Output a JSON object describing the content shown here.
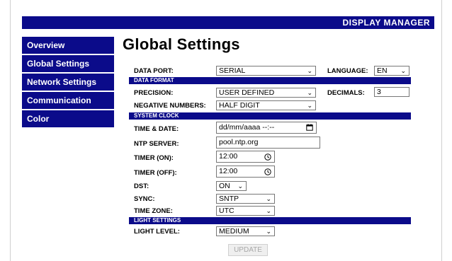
{
  "header": {
    "title": "DISPLAY MANAGER"
  },
  "sidebar": {
    "items": [
      {
        "label": "Overview"
      },
      {
        "label": "Global Settings"
      },
      {
        "label": "Network Settings"
      },
      {
        "label": "Communication"
      },
      {
        "label": "Color"
      }
    ]
  },
  "main": {
    "title": "Global Settings",
    "data_port": {
      "label": "DATA PORT:",
      "value": "SERIAL"
    },
    "language": {
      "label": "LANGUAGE:",
      "value": "EN"
    },
    "data_format": {
      "header": "DATA FORMAT",
      "precision": {
        "label": "PRECISION:",
        "value": "USER DEFINED"
      },
      "decimals": {
        "label": "DECIMALS:",
        "value": "3"
      },
      "negative_numbers": {
        "label": "NEGATIVE NUMBERS:",
        "value": "HALF DIGIT"
      }
    },
    "system_clock": {
      "header": "SYSTEM CLOCK",
      "time_date": {
        "label": "TIME & DATE:",
        "placeholder": "dd/mm/aaaa --:--"
      },
      "ntp_server": {
        "label": "NTP SERVER:",
        "value": "pool.ntp.org"
      },
      "timer_on": {
        "label": "TIMER (ON):",
        "value": "12:00"
      },
      "timer_off": {
        "label": "TIMER (OFF):",
        "value": "12:00"
      },
      "dst": {
        "label": "DST:",
        "value": "ON"
      },
      "sync": {
        "label": "SYNC:",
        "value": "SNTP"
      },
      "time_zone": {
        "label": "TIME ZONE:",
        "value": "UTC"
      }
    },
    "light_settings": {
      "header": "LIGHT SETTINGS",
      "light_level": {
        "label": "LIGHT LEVEL:",
        "value": "MEDIUM"
      }
    },
    "update_label": "UPDATE"
  }
}
